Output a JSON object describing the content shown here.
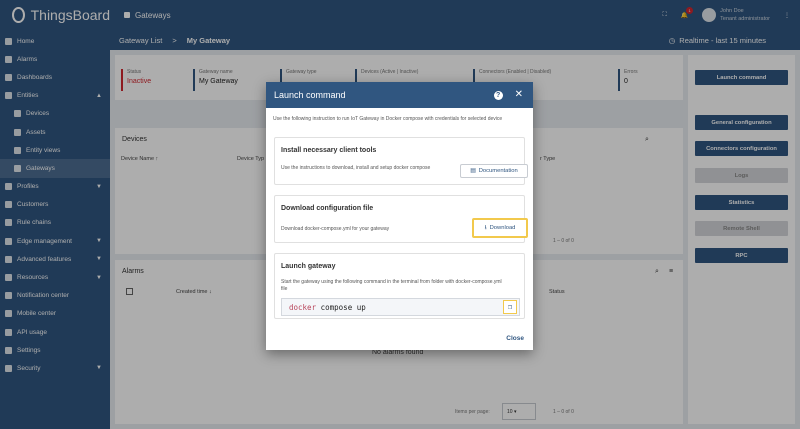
{
  "app": {
    "name": "ThingsBoard"
  },
  "topbar": {
    "section": "Gateways",
    "user_name": "John Doe",
    "user_role": "Tenant administrator",
    "notif_count": "1"
  },
  "breadcrumb": {
    "parent": "Gateway List",
    "sep": ">",
    "current": "My Gateway"
  },
  "time_window": "Realtime - last 15 minutes",
  "sidebar": {
    "items": [
      {
        "label": "Home",
        "icon": "home-icon"
      },
      {
        "label": "Alarms",
        "icon": "alarm-icon"
      },
      {
        "label": "Dashboards",
        "icon": "dashboard-icon"
      },
      {
        "label": "Entities",
        "icon": "entities-icon",
        "chevron": "▲"
      },
      {
        "label": "Devices",
        "icon": "device-icon",
        "sub": true
      },
      {
        "label": "Assets",
        "icon": "asset-icon",
        "sub": true
      },
      {
        "label": "Entity views",
        "icon": "entity-view-icon",
        "sub": true
      },
      {
        "label": "Gateways",
        "icon": "gateway-icon",
        "sub": true,
        "active": true
      },
      {
        "label": "Profiles",
        "icon": "profile-icon",
        "chevron": "▼"
      },
      {
        "label": "Customers",
        "icon": "customer-icon"
      },
      {
        "label": "Rule chains",
        "icon": "rule-chain-icon"
      },
      {
        "label": "Edge management",
        "icon": "edge-icon",
        "chevron": "▼"
      },
      {
        "label": "Advanced features",
        "icon": "advanced-icon",
        "chevron": "▼"
      },
      {
        "label": "Resources",
        "icon": "resource-icon",
        "chevron": "▼"
      },
      {
        "label": "Notification center",
        "icon": "notification-icon"
      },
      {
        "label": "Mobile center",
        "icon": "mobile-icon"
      },
      {
        "label": "API usage",
        "icon": "api-icon"
      },
      {
        "label": "Settings",
        "icon": "settings-icon"
      },
      {
        "label": "Security",
        "icon": "security-icon",
        "chevron": "▼"
      }
    ]
  },
  "status": {
    "status_label": "Status",
    "status_value": "Inactive",
    "name_label": "Gateway name",
    "name_value": "My Gateway",
    "type_label": "Gateway type",
    "devices_label": "Devices (Active | Inactive)",
    "connectors_label": "Connectors (Enabled | Disabled)",
    "errors_label": "Errors",
    "errors_value": "0"
  },
  "devices_panel": {
    "title": "Devices",
    "col1": "Device Name ↑",
    "col2": "Device Typ",
    "col3": "r Type",
    "pager": "1 – 0 of 0"
  },
  "alarms_panel": {
    "title": "Alarms",
    "col1": "Created time ↓",
    "col2": "Status",
    "empty": "No alarms found",
    "items_per_page": "Items per page:",
    "ipp_value": "10",
    "pager": "1 – 0 of 0"
  },
  "right_actions": {
    "launch": "Launch command",
    "general": "General configuration",
    "connectors": "Connectors configuration",
    "logs": "Logs",
    "statistics": "Statistics",
    "remote_shell": "Remote Shell",
    "rpc": "RPC"
  },
  "dialog": {
    "title": "Launch command",
    "intro": "Use the following instruction to run IoT Gateway in Docker compose with credentials for selected device",
    "install_title": "Install necessary client tools",
    "install_desc": "Use the instructions to download, install and setup docker compose",
    "documentation": "Documentation",
    "download_title": "Download configuration file",
    "download_desc": "Download docker-compose.yml for your gateway",
    "download": "Download",
    "launch_title": "Launch gateway",
    "launch_desc": "Start the gateway using the following command in the terminal from folder with docker-compose.yml file",
    "cmd_kw": "docker",
    "cmd_rest": " compose up",
    "close": "Close"
  }
}
